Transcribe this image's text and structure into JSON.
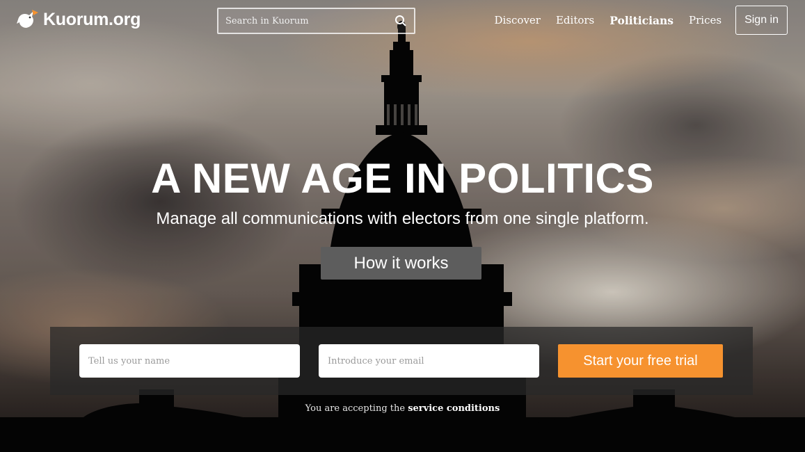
{
  "header": {
    "logo_text": "Kuorum.org",
    "search": {
      "placeholder": "Search in Kuorum"
    },
    "nav": [
      {
        "label": "Discover"
      },
      {
        "label": "Editors"
      },
      {
        "label": "Politicians",
        "active": true
      },
      {
        "label": "Prices"
      }
    ],
    "signin_label": "Sign in"
  },
  "hero": {
    "title": "A NEW AGE IN POLITICS",
    "subtitle": "Manage all communications with electors from one single platform.",
    "how_button_label": "How it works"
  },
  "signup": {
    "name_placeholder": "Tell us your name",
    "email_placeholder": "Introduce your email",
    "trial_button_label": "Start your free trial",
    "terms_prefix": "You are accepting the",
    "terms_link": "service conditions"
  },
  "icons": {
    "logo": "bird-icon",
    "search": "search-icon"
  },
  "colors": {
    "accent": "#f6922f",
    "how_button_bg": "#5d5d5d"
  }
}
